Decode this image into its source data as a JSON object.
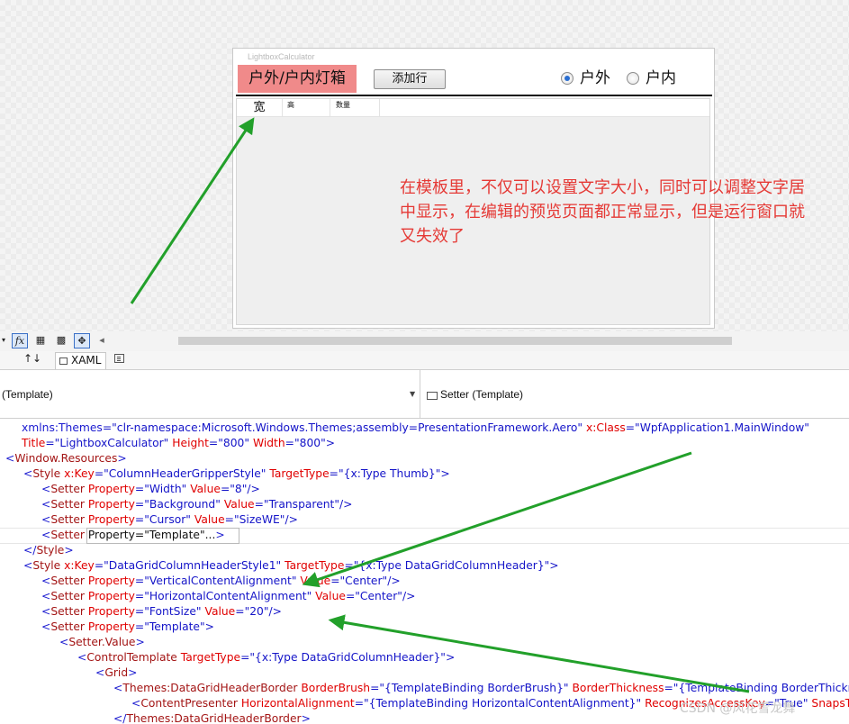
{
  "designer": {
    "window_title": "LightboxCalculator",
    "app_title": "户外/户内灯箱",
    "add_row_button": "添加行",
    "radio_outdoor": "户外",
    "radio_indoor": "户内",
    "outdoor_checked": true,
    "columns": [
      "宽",
      "高",
      "数量"
    ]
  },
  "annotation": "在模板里，不仅可以设置文字大小，同时可以调整文字居中显示，在编辑的预览页面都正常显示，但是运行窗口就又失效了",
  "toolbar": {
    "fx_label": "fx",
    "arrow_icon": "triangle-left-icon"
  },
  "tabs": {
    "swap_icon": "↑↓",
    "xaml_tab": "XAML"
  },
  "navbar": {
    "left": "(Template)",
    "right": "Setter (Template)"
  },
  "code_lines": [
    [
      [
        "p",
        "xmlns:Themes"
      ],
      [
        "v",
        "=\"clr-namespace:Microsoft.Windows.Themes;assembly=PresentationFramework.Aero\""
      ],
      [
        "p",
        " "
      ],
      [
        "a",
        "x:Class"
      ],
      [
        "v",
        "=\"WpfApplication1.MainWindow\""
      ]
    ],
    [
      [
        "a",
        "Title"
      ],
      [
        "v",
        "=\"LightboxCalculator\""
      ],
      [
        "t",
        " "
      ],
      [
        "a",
        "Height"
      ],
      [
        "v",
        "=\"800\""
      ],
      [
        "t",
        " "
      ],
      [
        "a",
        "Width"
      ],
      [
        "v",
        "=\"800\">"
      ]
    ],
    [
      [
        "p",
        "<"
      ],
      [
        "e",
        "Window.Resources"
      ],
      [
        "p",
        ">"
      ]
    ],
    [
      [
        "p",
        "<"
      ],
      [
        "e",
        "Style"
      ],
      [
        "t",
        " "
      ],
      [
        "a",
        "x:Key"
      ],
      [
        "v",
        "=\"ColumnHeaderGripperStyle\""
      ],
      [
        "t",
        " "
      ],
      [
        "a",
        "TargetType"
      ],
      [
        "v",
        "=\"{x:Type Thumb}\">"
      ]
    ],
    [
      [
        "p",
        "<"
      ],
      [
        "e",
        "Setter"
      ],
      [
        "t",
        " "
      ],
      [
        "a",
        "Property"
      ],
      [
        "v",
        "=\"Width\""
      ],
      [
        "t",
        " "
      ],
      [
        "a",
        "Value"
      ],
      [
        "v",
        "=\"8\"/>"
      ]
    ],
    [
      [
        "p",
        "<"
      ],
      [
        "e",
        "Setter"
      ],
      [
        "t",
        " "
      ],
      [
        "a",
        "Property"
      ],
      [
        "v",
        "=\"Background\""
      ],
      [
        "t",
        " "
      ],
      [
        "a",
        "Value"
      ],
      [
        "v",
        "=\"Transparent\"/>"
      ]
    ],
    [
      [
        "p",
        "<"
      ],
      [
        "e",
        "Setter"
      ],
      [
        "t",
        " "
      ],
      [
        "a",
        "Property"
      ],
      [
        "v",
        "=\"Cursor\""
      ],
      [
        "t",
        " "
      ],
      [
        "a",
        "Value"
      ],
      [
        "v",
        "=\"SizeWE\"/>"
      ]
    ],
    [
      [
        "p",
        "<"
      ],
      [
        "e",
        "Setter"
      ],
      [
        "t",
        " Property=\"Template\"..."
      ],
      [
        "p",
        ">"
      ]
    ],
    [
      [
        "p",
        "</"
      ],
      [
        "e",
        "Style"
      ],
      [
        "p",
        ">"
      ]
    ],
    [
      [
        "p",
        "<"
      ],
      [
        "e",
        "Style"
      ],
      [
        "t",
        " "
      ],
      [
        "a",
        "x:Key"
      ],
      [
        "v",
        "=\"DataGridColumnHeaderStyle1\""
      ],
      [
        "t",
        " "
      ],
      [
        "a",
        "TargetType"
      ],
      [
        "v",
        "=\"{x:Type DataGridColumnHeader}\">"
      ]
    ],
    [
      [
        "p",
        "<"
      ],
      [
        "e",
        "Setter"
      ],
      [
        "t",
        " "
      ],
      [
        "a",
        "Property"
      ],
      [
        "v",
        "=\"VerticalContentAlignment\""
      ],
      [
        "t",
        " "
      ],
      [
        "a",
        "Value"
      ],
      [
        "v",
        "=\"Center\"/>"
      ]
    ],
    [
      [
        "p",
        "<"
      ],
      [
        "e",
        "Setter"
      ],
      [
        "t",
        " "
      ],
      [
        "a",
        "Property"
      ],
      [
        "v",
        "=\"HorizontalContentAlignment\""
      ],
      [
        "t",
        " "
      ],
      [
        "a",
        "Value"
      ],
      [
        "v",
        "=\"Center\"/>"
      ]
    ],
    [
      [
        "p",
        "<"
      ],
      [
        "e",
        "Setter"
      ],
      [
        "t",
        " "
      ],
      [
        "a",
        "Property"
      ],
      [
        "v",
        "=\"FontSize\""
      ],
      [
        "t",
        " "
      ],
      [
        "a",
        "Value"
      ],
      [
        "v",
        "=\"20\"/>"
      ]
    ],
    [
      [
        "p",
        "<"
      ],
      [
        "e",
        "Setter"
      ],
      [
        "t",
        " "
      ],
      [
        "a",
        "Property"
      ],
      [
        "v",
        "=\"Template\">"
      ]
    ],
    [
      [
        "p",
        "<"
      ],
      [
        "e",
        "Setter.Value"
      ],
      [
        "p",
        ">"
      ]
    ],
    [
      [
        "p",
        "<"
      ],
      [
        "e",
        "ControlTemplate"
      ],
      [
        "t",
        " "
      ],
      [
        "a",
        "TargetType"
      ],
      [
        "v",
        "=\"{x:Type DataGridColumnHeader}\">"
      ]
    ],
    [
      [
        "p",
        "<"
      ],
      [
        "e",
        "Grid"
      ],
      [
        "p",
        ">"
      ]
    ],
    [
      [
        "p",
        "<"
      ],
      [
        "e",
        "Themes:DataGridHeaderBorder"
      ],
      [
        "t",
        " "
      ],
      [
        "a",
        "BorderBrush"
      ],
      [
        "v",
        "=\"{TemplateBinding BorderBrush}\""
      ],
      [
        "t",
        " "
      ],
      [
        "a",
        "BorderThickness"
      ],
      [
        "v",
        "=\"{TemplateBinding BorderThickness}\""
      ]
    ],
    [
      [
        "p",
        "<"
      ],
      [
        "e",
        "ContentPresenter"
      ],
      [
        "t",
        " "
      ],
      [
        "a",
        "HorizontalAlignment"
      ],
      [
        "v",
        "=\"{TemplateBinding HorizontalContentAlignment}\""
      ],
      [
        "t",
        " "
      ],
      [
        "a",
        "RecognizesAccessKey"
      ],
      [
        "v",
        "=\"True\""
      ],
      [
        "t",
        " "
      ],
      [
        "a",
        "SnapsToDevicePixels"
      ],
      [
        "v",
        "=\"{TemplateBinding SnapsToDevicePixels}\""
      ]
    ],
    [
      [
        "p",
        "</"
      ],
      [
        "e",
        "Themes:DataGridHeaderBorder"
      ],
      [
        "p",
        ">"
      ]
    ]
  ],
  "watermark": "CSDN @风花雪龙舞"
}
